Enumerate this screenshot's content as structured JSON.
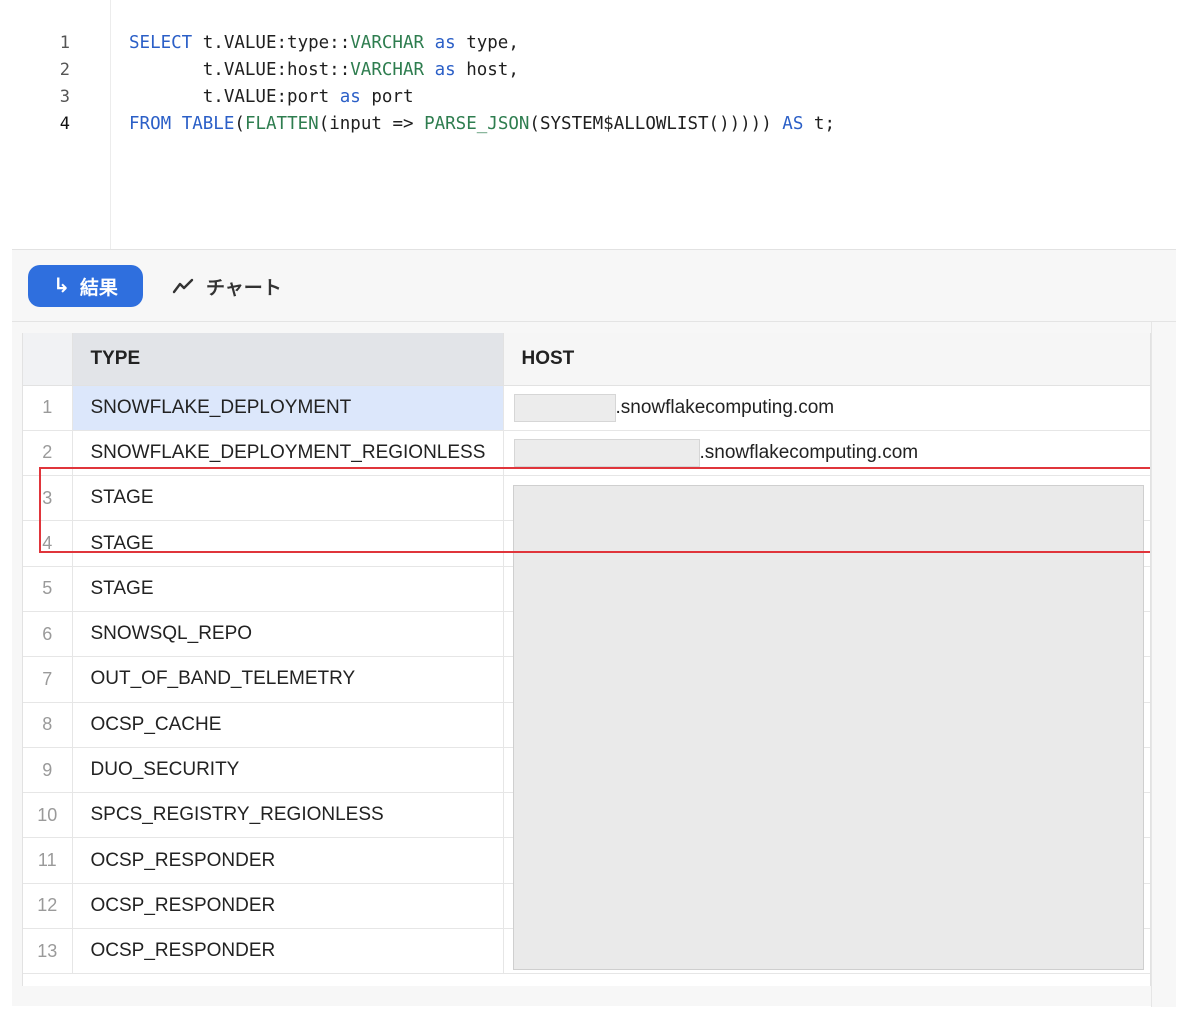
{
  "editor": {
    "line_numbers": [
      "1",
      "2",
      "3",
      "4"
    ],
    "lines": [
      [
        {
          "t": "SELECT",
          "c": "kw"
        },
        {
          "t": " t.VALUE:type::",
          "c": "pl"
        },
        {
          "t": "VARCHAR",
          "c": "fn"
        },
        {
          "t": " ",
          "c": "pl"
        },
        {
          "t": "as",
          "c": "kw"
        },
        {
          "t": " type,",
          "c": "pl"
        }
      ],
      [
        {
          "t": "       t.VALUE:host::",
          "c": "pl"
        },
        {
          "t": "VARCHAR",
          "c": "fn"
        },
        {
          "t": " ",
          "c": "pl"
        },
        {
          "t": "as",
          "c": "kw"
        },
        {
          "t": " host,",
          "c": "pl"
        }
      ],
      [
        {
          "t": "       t.VALUE:port ",
          "c": "pl"
        },
        {
          "t": "as",
          "c": "kw"
        },
        {
          "t": " port",
          "c": "pl"
        }
      ],
      [
        {
          "t": "FROM",
          "c": "kw"
        },
        {
          "t": " ",
          "c": "pl"
        },
        {
          "t": "TABLE",
          "c": "kw"
        },
        {
          "t": "(",
          "c": "pl"
        },
        {
          "t": "FLATTEN",
          "c": "fn"
        },
        {
          "t": "(input => ",
          "c": "pl"
        },
        {
          "t": "PARSE_JSON",
          "c": "fn"
        },
        {
          "t": "(SYSTEM$ALLOWLIST())))) ",
          "c": "pl"
        },
        {
          "t": "AS",
          "c": "kw"
        },
        {
          "t": " t;",
          "c": "pl"
        }
      ]
    ]
  },
  "tabs": {
    "results_label": "結果",
    "results_icon": "arrow-return-icon",
    "chart_label": "チャート",
    "chart_icon": "line-chart-icon"
  },
  "grid": {
    "headers": {
      "type": "TYPE",
      "host": "HOST"
    },
    "host_suffix": ".snowflakecomputing.com",
    "rows": [
      {
        "idx": "1",
        "type": "SNOWFLAKE_DEPLOYMENT"
      },
      {
        "idx": "2",
        "type": "SNOWFLAKE_DEPLOYMENT_REGIONLESS"
      },
      {
        "idx": "3",
        "type": "STAGE"
      },
      {
        "idx": "4",
        "type": "STAGE"
      },
      {
        "idx": "5",
        "type": "STAGE"
      },
      {
        "idx": "6",
        "type": "SNOWSQL_REPO"
      },
      {
        "idx": "7",
        "type": "OUT_OF_BAND_TELEMETRY"
      },
      {
        "idx": "8",
        "type": "OCSP_CACHE"
      },
      {
        "idx": "9",
        "type": "DUO_SECURITY"
      },
      {
        "idx": "10",
        "type": "SPCS_REGISTRY_REGIONLESS"
      },
      {
        "idx": "11",
        "type": "OCSP_RESPONDER"
      },
      {
        "idx": "12",
        "type": "OCSP_RESPONDER"
      },
      {
        "idx": "13",
        "type": "OCSP_RESPONDER"
      }
    ]
  },
  "colors": {
    "accent": "#2f6fde",
    "keyword": "#2b5fc7",
    "function": "#2e7d4f",
    "highlight_border": "#e0353b",
    "selected_cell": "#dce7fb"
  }
}
